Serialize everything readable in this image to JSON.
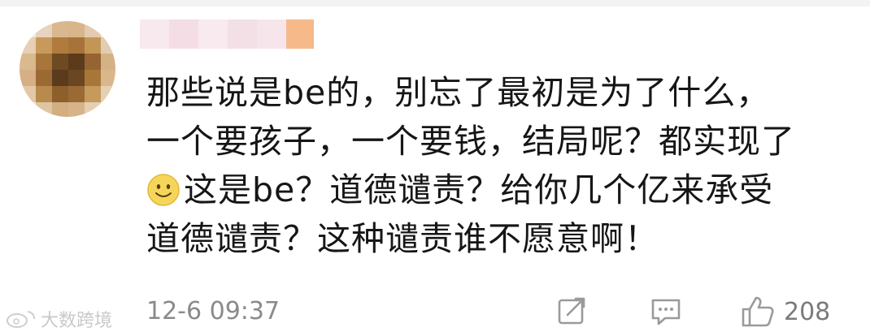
{
  "comment": {
    "lines": [
      "那些说是be的，别忘了最初是为了什么，",
      "一个要孩子，一个要钱，结局呢？都实现了",
      "这是be？道德谴责？给你几个亿来承受",
      "道德谴责？这种谴责谁不愿意啊！"
    ],
    "emoji": "smile-emoji"
  },
  "meta": {
    "timestamp": "12-6 09:37",
    "like_count": "208"
  },
  "watermark": {
    "text": "大数跨境"
  },
  "colors": {
    "text": "#161616",
    "meta": "#8a8a8a",
    "icon": "#9a9a9a",
    "emoji_face": "#f6d65a"
  },
  "icons": [
    "share-icon",
    "comment-icon",
    "like-icon",
    "weibo-logo-icon"
  ]
}
